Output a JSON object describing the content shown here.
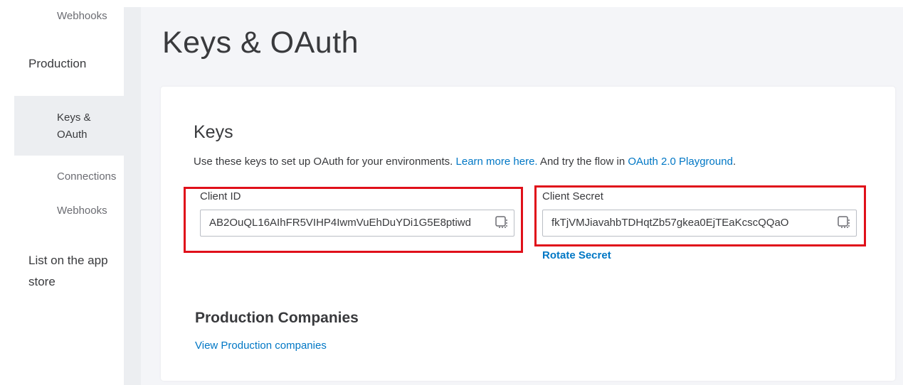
{
  "sidebar": {
    "items": [
      {
        "label": "Webhooks"
      },
      {
        "label": "Production"
      },
      {
        "label": "Keys & OAuth"
      },
      {
        "label": "Connections"
      },
      {
        "label": "Webhooks"
      },
      {
        "label": "List on the app store"
      }
    ]
  },
  "page": {
    "title": "Keys & OAuth"
  },
  "keys": {
    "heading": "Keys",
    "desc_prefix": "Use these keys to set up OAuth for your environments. ",
    "learn_more": "Learn more here.",
    "desc_middle": " And try the flow in ",
    "playground": "OAuth 2.0 Playground",
    "desc_suffix": ".",
    "client_id_label": "Client ID",
    "client_id_value": "AB2OuQL16AIhFR5VIHP4IwmVuEhDuYDi1G5E8ptiwd",
    "client_secret_label": "Client Secret",
    "client_secret_value": "fkTjVMJiavahbTDHqtZb57gkea0EjTEaKcscQQaO",
    "rotate_label": "Rotate Secret",
    "copy_icon": "copy-icon"
  },
  "production": {
    "heading": "Production Companies",
    "view_link": "View Production companies"
  },
  "colors": {
    "accent_link": "#0077c5",
    "highlight": "#e0101a",
    "text": "#393a3d"
  }
}
